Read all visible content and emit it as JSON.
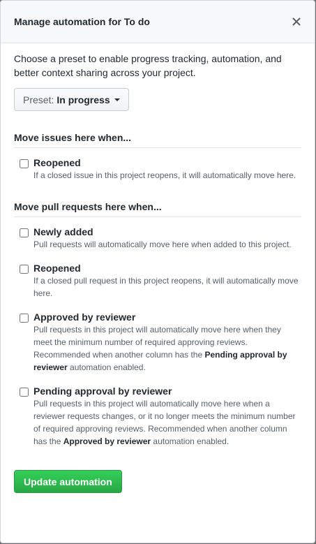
{
  "dialog": {
    "title": "Manage automation for To do",
    "close_icon": "close-x-icon"
  },
  "intro": "Choose a preset to enable progress tracking, automation, and better context sharing across your project.",
  "preset": {
    "label": "Preset:",
    "value": "In progress",
    "icon": "caret-down-icon"
  },
  "issues_section": {
    "title": "Move issues here when...",
    "options": [
      {
        "label": "Reopened",
        "description": "If a closed issue in this project reopens, it will automatically move here.",
        "checked": false
      }
    ]
  },
  "pr_section": {
    "title": "Move pull requests here when...",
    "options": [
      {
        "label": "Newly added",
        "description": "Pull requests will automatically move here when added to this project.",
        "checked": false
      },
      {
        "label": "Reopened",
        "description": "If a closed pull request in this project reopens, it will automatically move here.",
        "checked": false
      },
      {
        "label": "Approved by reviewer",
        "description_pre": "Pull requests in this project will automatically move here when they meet the minimum number of required approving reviews. Recommended when another column has the ",
        "description_bold": "Pending approval by reviewer",
        "description_post": " automation enabled.",
        "checked": false
      },
      {
        "label": "Pending approval by reviewer",
        "description_pre": "Pull requests in this project will automatically move here when a reviewer requests changes, or it no longer meets the minimum number of required approving reviews. Recommended when another column has the ",
        "description_bold": "Approved by reviewer",
        "description_post": " automation enabled.",
        "checked": false
      }
    ]
  },
  "submit_label": "Update automation",
  "colors": {
    "primary_button": "#2ea44f",
    "header_bg": "#f6f8fa",
    "muted_text": "#586069"
  }
}
